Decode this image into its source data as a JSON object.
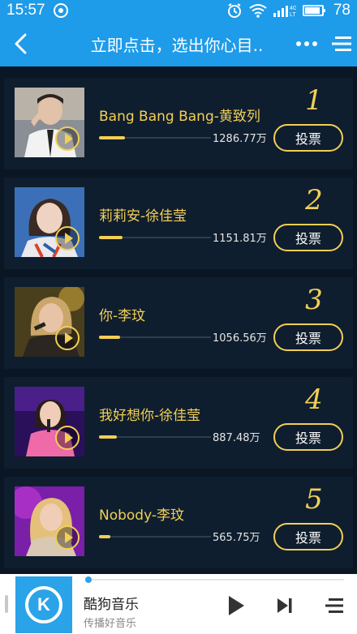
{
  "status_bar": {
    "time": "15:57",
    "battery_level": "78",
    "icons": [
      "sync-icon",
      "alarm-icon",
      "wifi-icon",
      "signal-4g-icon",
      "battery-icon"
    ]
  },
  "header": {
    "title": "立即点击，选出你心目..",
    "icons": [
      "back-arrow-icon",
      "more-dots-icon",
      "menu-lines-icon"
    ],
    "background_color": "#1e9be9"
  },
  "chart_items": [
    {
      "rank": "1",
      "song": "Bang Bang Bang-黄致列",
      "votes": "1286.77万",
      "progress": 0.23,
      "vote_label": "投票"
    },
    {
      "rank": "2",
      "song": "莉莉安-徐佳莹",
      "votes": "1151.81万",
      "progress": 0.21,
      "vote_label": "投票"
    },
    {
      "rank": "3",
      "song": "你-李玟",
      "votes": "1056.56万",
      "progress": 0.19,
      "vote_label": "投票"
    },
    {
      "rank": "4",
      "song": "我好想你-徐佳莹",
      "votes": "887.48万",
      "progress": 0.16,
      "vote_label": "投票"
    },
    {
      "rank": "5",
      "song": "Nobody-李玟",
      "votes": "565.75万",
      "progress": 0.1,
      "vote_label": "投票"
    }
  ],
  "player": {
    "app_name": "酷狗音乐",
    "slogan": "传播好音乐",
    "icons": [
      "kugou-logo-icon",
      "play-icon",
      "next-track-icon",
      "playlist-icon"
    ],
    "accent_color": "#2aa3e8"
  },
  "colors": {
    "gold": "#f2cf55",
    "card_background": "#0f1e2e"
  }
}
